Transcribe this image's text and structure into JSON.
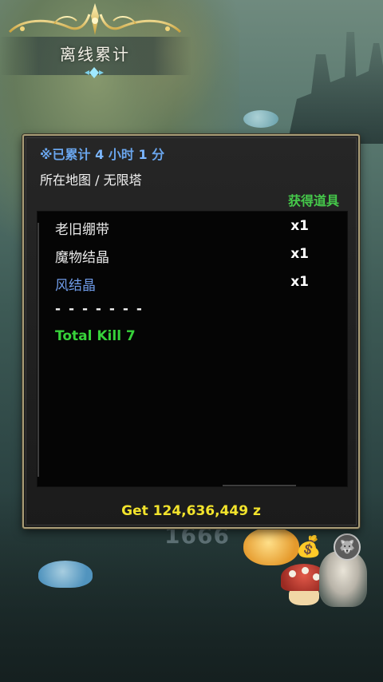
{
  "title": "离线累计",
  "summary": {
    "prefix": "※已累计 ",
    "hours": "4",
    "hours_unit": " 小时 ",
    "minutes": "1",
    "minutes_unit": " 分",
    "map_label": "所在地图 / 无限塔"
  },
  "items_header": "获得道具",
  "items": [
    {
      "name": "老旧绷带",
      "qty": "x1",
      "color": "#e9e9e9"
    },
    {
      "name": "魔物结晶",
      "qty": "x1",
      "color": "#e9e9e9"
    },
    {
      "name": "风结晶",
      "qty": "x1",
      "color": "#6f9be8"
    }
  ],
  "divider": "- - - - - - -",
  "total_kill": "Total Kill 7",
  "gold_reward": "Get 124,636,449 z",
  "background": {
    "damage_number": "1666",
    "hud_icons": [
      "loot-bag-icon",
      "wolf-pet-icon"
    ]
  },
  "colors": {
    "summary_blue": "#6aa6ee",
    "items_green": "#45c84a",
    "kill_green": "#37d23a",
    "gold_yellow": "#f2e32c",
    "frame_gold": "#a89c76"
  }
}
